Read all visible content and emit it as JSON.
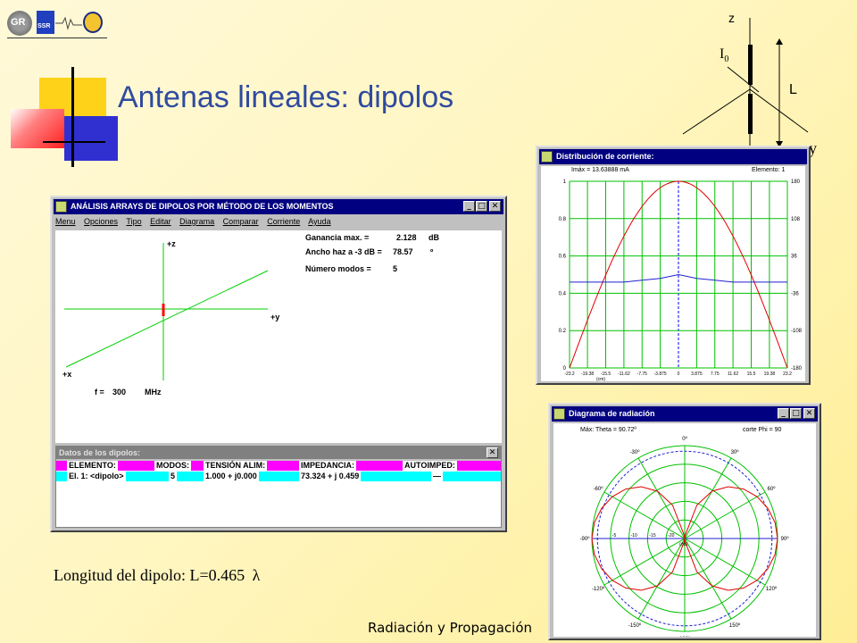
{
  "slide": {
    "title": "Antenas lineales: dipolos",
    "caption_prefix": "Longitud del dipolo: L=0.465",
    "caption_symbol": "λ",
    "footer": "Radiación y Propagación"
  },
  "logos": {
    "gr": "GR",
    "ssr": "SSR"
  },
  "axes_figure": {
    "z": "z",
    "y": "y",
    "x": "x",
    "current": "I",
    "current_sub": "0",
    "length": "L"
  },
  "main_window": {
    "title": "ANÁLISIS ARRAYS DE DIPOLOS POR MÉTODO DE LOS MOMENTOS",
    "menu": [
      "Menu",
      "Opciones",
      "Tipo",
      "Editar",
      "Diagrama",
      "Comparar",
      "Corriente",
      "Ayuda"
    ],
    "axis_z": "+z",
    "axis_y": "+y",
    "axis_x": "+x",
    "freq_label": "f =",
    "freq_value": "300",
    "freq_unit": "MHz",
    "gain_label": "Ganancia max. =",
    "gain_value": "2.128",
    "gain_unit": "dB",
    "beam_label": "Ancho haz a -3  dB =",
    "beam_value": "78.57",
    "beam_unit": "º",
    "modes_label": "Número modos =",
    "modes_value": "5"
  },
  "dipole_data_window": {
    "title": "Datos de los dipolos:",
    "headers": [
      "ELEMENTO:",
      "MODOS:",
      "TENSIÓN ALIM:",
      "IMPEDANCIA:",
      "AUTOIMPED:"
    ],
    "row": [
      "El. 1: <dipolo>",
      "5",
      "1.000 + j0.000",
      "73.324 + j 0.459",
      "—"
    ]
  },
  "current_window": {
    "title": "Distribución de corriente:",
    "max_label": "Imáx = 13.63888 mA",
    "element_label": "Elemento: 1",
    "y_left_ticks": [
      "1",
      "0.8",
      "0.6",
      "0.4",
      "0.2",
      "0"
    ],
    "y_right_ticks": [
      "180",
      "108",
      "36",
      "-36",
      "-108",
      "-180"
    ],
    "x_ticks": [
      "-23.2",
      "-19.38",
      "-15.5",
      "-11.62",
      "-7.75",
      "-3.875",
      "0",
      "3.875",
      "7.75",
      "11.62",
      "15.5",
      "19.38",
      "23.2"
    ],
    "x_unit": "(cm)"
  },
  "pattern_window": {
    "title": "Diagrama de radiación",
    "max_label": "Máx: Theta = 90.72º",
    "cut_label": "corte Phi = 90",
    "angle_labels": [
      "0º",
      "30º",
      "60º",
      "90º",
      "120º",
      "150º",
      "180º",
      "-150º",
      "-120º",
      "-90º",
      "-60º",
      "-30º"
    ],
    "radial_labels": [
      "-5",
      "-10",
      "-15",
      "-20"
    ],
    "db_unit": "(dB)"
  },
  "chart_data": [
    {
      "type": "line",
      "title": "Distribución de corriente:",
      "xlabel": "(cm)",
      "x": [
        -23.2,
        -19.38,
        -15.5,
        -11.62,
        -7.75,
        -3.875,
        0,
        3.875,
        7.75,
        11.62,
        15.5,
        19.38,
        23.2
      ],
      "series": [
        {
          "values": [
            0,
            0.26,
            0.5,
            0.7,
            0.86,
            0.96,
            1,
            0.96,
            0.86,
            0.7,
            0.5,
            0.26,
            0
          ]
        },
        {
          "values": [
            0.46,
            0.46,
            0.46,
            0.46,
            0.47,
            0.48,
            0.5,
            0.48,
            0.47,
            0.46,
            0.46,
            0.46,
            0.46
          ]
        }
      ],
      "ylim": [
        0,
        1
      ],
      "y_right_ticks": [
        180,
        108,
        36,
        -36,
        -108,
        -180
      ],
      "grid": true
    },
    {
      "type": "polar",
      "title": "Diagrama de radiación",
      "angles_deg": [
        0,
        10,
        20,
        30,
        40,
        50,
        60,
        70,
        80,
        90,
        100,
        110,
        120,
        130,
        140,
        150,
        160,
        170,
        180
      ],
      "series": [
        {
          "values_db": [
            -40,
            -24,
            -15.4,
            -10.3,
            -6.8,
            -4.3,
            -2.5,
            -1.2,
            -0.3,
            0,
            -0.3,
            -1.2,
            -2.5,
            -4.3,
            -6.8,
            -10.3,
            -15.4,
            -24,
            -40
          ]
        },
        {
          "values_db": [
            -1.5,
            -1.5,
            -1.5,
            -1.5,
            -1.5,
            -1.5,
            -1.5,
            -1.5,
            -1.5,
            -1.5,
            -1.5,
            -1.5,
            -1.5,
            -1.5,
            -1.5,
            -1.5,
            -1.5,
            -1.5,
            -1.5
          ]
        }
      ],
      "rlim_db": [
        -25,
        0
      ],
      "radial_ticks_db": [
        -5,
        -10,
        -15,
        -20
      ],
      "grid": true
    }
  ],
  "colors": {
    "title": "#2f4aa0",
    "titlebar": "#000080",
    "magenta": "#ff00ff",
    "cyan": "#00ffff",
    "green_grid": "#00c000"
  }
}
